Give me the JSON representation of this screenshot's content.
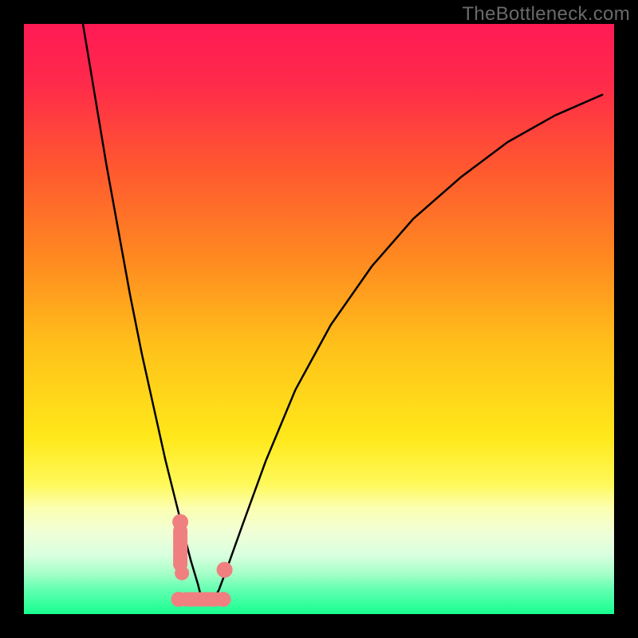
{
  "watermark": "TheBottleneck.com",
  "chart_data": {
    "type": "line",
    "title": "",
    "xlabel": "",
    "ylabel": "",
    "xlim": [
      0,
      100
    ],
    "ylim": [
      0,
      100
    ],
    "grid": false,
    "legend": false,
    "background_gradient": {
      "stops": [
        {
          "pos": 0.0,
          "color": "#ff1a55"
        },
        {
          "pos": 0.1,
          "color": "#ff2a4a"
        },
        {
          "pos": 0.25,
          "color": "#ff5a2f"
        },
        {
          "pos": 0.4,
          "color": "#ff8a20"
        },
        {
          "pos": 0.55,
          "color": "#ffc21a"
        },
        {
          "pos": 0.7,
          "color": "#ffe81a"
        },
        {
          "pos": 0.78,
          "color": "#fff95a"
        },
        {
          "pos": 0.82,
          "color": "#fcffb0"
        },
        {
          "pos": 0.86,
          "color": "#f1ffd6"
        },
        {
          "pos": 0.9,
          "color": "#d9ffdf"
        },
        {
          "pos": 0.93,
          "color": "#a8ffc8"
        },
        {
          "pos": 0.96,
          "color": "#5fffb0"
        },
        {
          "pos": 1.0,
          "color": "#17ff8f"
        }
      ]
    },
    "series": [
      {
        "name": "bottleneck-curve",
        "color": "#000000",
        "stroke_width": 2.5,
        "x": [
          10.0,
          12.0,
          14.0,
          16.0,
          18.0,
          20.0,
          22.0,
          24.0,
          25.5,
          27.0,
          28.3,
          29.5,
          30.0,
          31.0,
          32.0,
          33.0,
          34.5,
          37.0,
          41.0,
          46.0,
          52.0,
          59.0,
          66.0,
          74.0,
          82.0,
          90.0,
          98.0
        ],
        "y": [
          100.0,
          88.0,
          76.0,
          65.0,
          54.0,
          44.0,
          35.0,
          26.0,
          20.0,
          14.0,
          9.0,
          5.0,
          3.0,
          2.0,
          2.5,
          4.0,
          8.0,
          15.0,
          26.0,
          38.0,
          49.0,
          59.0,
          67.0,
          74.0,
          80.0,
          84.5,
          88.0
        ]
      }
    ],
    "markers": [
      {
        "name": "cpu-region-marker",
        "shape": "rounded-blob",
        "color": "#f08080",
        "approx_center_x": 26.5,
        "approx_center_y": 11.0
      },
      {
        "name": "gpu-region-marker",
        "shape": "rounded-dot",
        "color": "#f08080",
        "approx_center_x": 34.0,
        "approx_center_y": 7.5
      },
      {
        "name": "sweet-spot-marker",
        "shape": "rounded-bar",
        "color": "#f08080",
        "approx_center_x": 30.0,
        "approx_center_y": 2.5
      }
    ]
  }
}
